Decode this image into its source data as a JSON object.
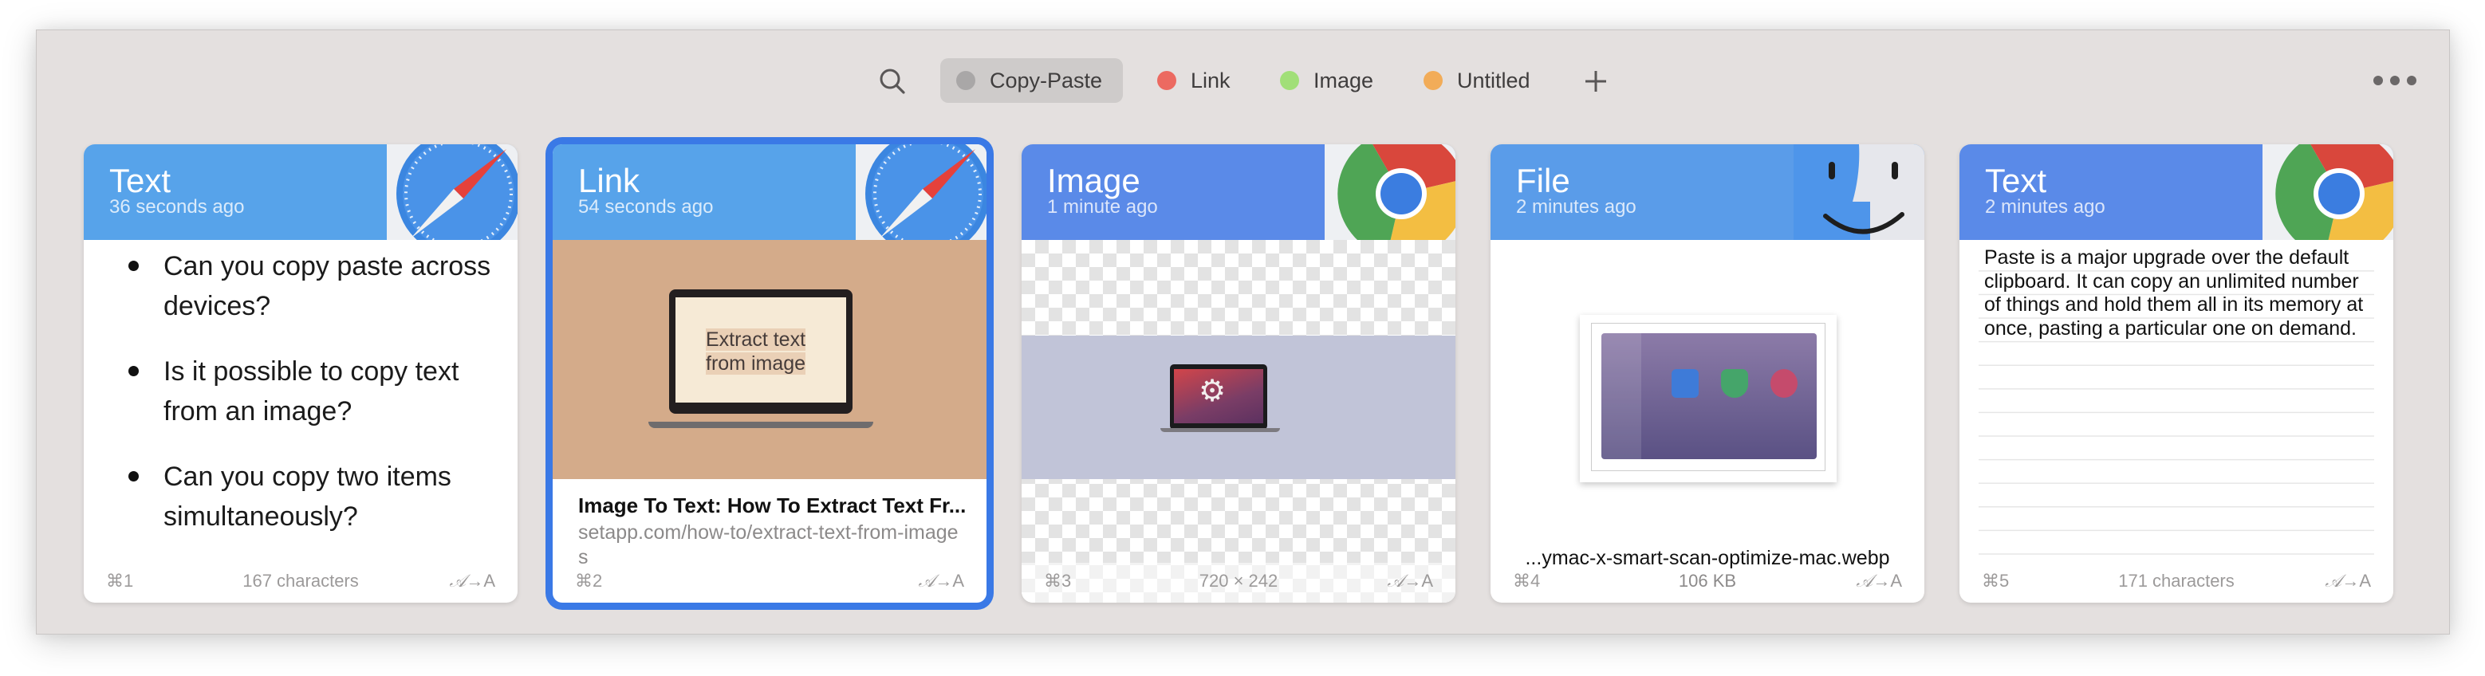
{
  "toolbar": {
    "tabs": [
      {
        "label": "Copy-Paste",
        "color": "#a9a7a7",
        "active": true
      },
      {
        "label": "Link",
        "color": "#ec6a61"
      },
      {
        "label": "Image",
        "color": "#a1df78"
      },
      {
        "label": "Untitled",
        "color": "#f2ac58"
      }
    ],
    "icons": {
      "search": "search-icon",
      "add": "plus-icon",
      "more": "more-icon"
    }
  },
  "accent": "#3a79e6",
  "cards": [
    {
      "type": "Text",
      "time": "36 seconds ago",
      "app": "safari",
      "header_color": "#57a3ea",
      "bullets": [
        "Can you copy paste across devices?",
        "Is it possible to copy text from an image?",
        "Can you copy two items simultaneously?"
      ],
      "shortcut": "⌘1",
      "meta": "167 characters",
      "convert": [
        "𝒜",
        "→A"
      ]
    },
    {
      "type": "Link",
      "time": "54 seconds ago",
      "app": "safari",
      "header_color": "#57a3ea",
      "selected": true,
      "preview_text": [
        "Extract text",
        "from image"
      ],
      "title": "Image To Text: How To Extract Text Fr...",
      "url": "setapp.com/how-to/extract-text-from-images",
      "shortcut": "⌘2",
      "meta": "",
      "convert": [
        "𝒜",
        "→A"
      ]
    },
    {
      "type": "Image",
      "time": "1 minute ago",
      "app": "chrome",
      "header_color": "#5a8ae8",
      "shortcut": "⌘3",
      "meta": "720 × 242",
      "convert": [
        "𝒜",
        "→A"
      ]
    },
    {
      "type": "File",
      "time": "2 minutes ago",
      "app": "finder",
      "header_color": "#5a9ce9",
      "file_name": "...ymac-x-smart-scan-optimize-mac.webp",
      "shortcut": "⌘4",
      "meta": "106 KB",
      "convert": [
        "𝒜",
        "→A"
      ]
    },
    {
      "type": "Text",
      "time": "2 minutes ago",
      "app": "chrome",
      "header_color": "#5a8ae8",
      "text": "Paste is a major upgrade over the default clipboard. It can copy an unlimited number of things and hold them all in its memory at once, pasting a particular one on demand.",
      "shortcut": "⌘5",
      "meta": "171 characters",
      "convert": [
        "𝒜",
        "→A"
      ]
    }
  ]
}
